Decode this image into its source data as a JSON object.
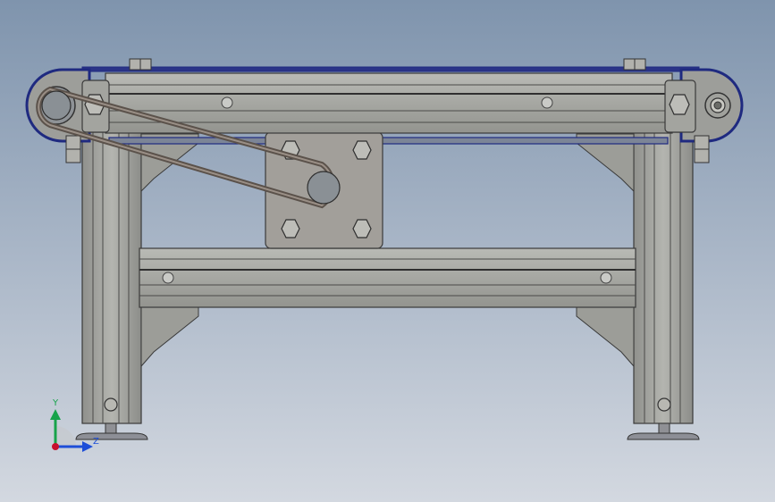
{
  "triad": {
    "y_label": "Y",
    "z_label": "Z",
    "x_color": "#c8102e",
    "y_color": "#17a34a",
    "z_color": "#1d4ed8"
  },
  "colors": {
    "background_top": "#7f94ad",
    "background_bottom": "#d3d8e0",
    "metal": "#a7a8a3",
    "belt": "#1f2a80",
    "outline": "#3a3a3a"
  }
}
